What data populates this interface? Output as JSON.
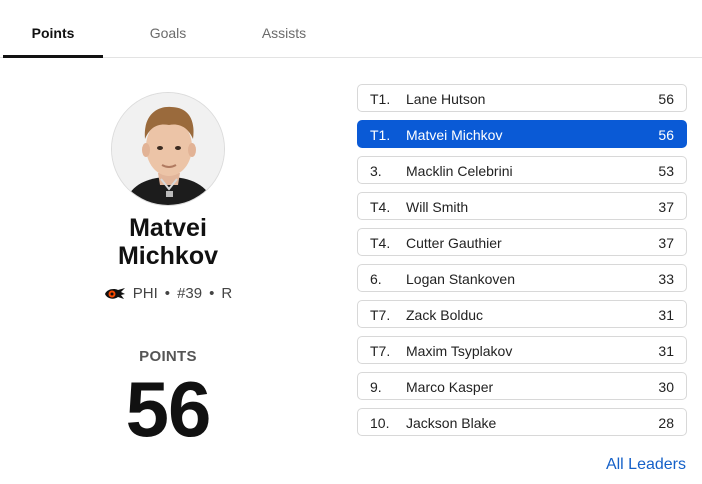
{
  "tabs": [
    {
      "label": "Points",
      "active": true
    },
    {
      "label": "Goals",
      "active": false
    },
    {
      "label": "Assists",
      "active": false
    }
  ],
  "player": {
    "first_name": "Matvei",
    "last_name": "Michkov",
    "team": "PHI",
    "number": "#39",
    "position": "R",
    "separator": "•",
    "stat_label": "POINTS",
    "stat_value": "56"
  },
  "leaders": [
    {
      "rank": "T1.",
      "name": "Lane Hutson",
      "value": "56",
      "highlight": false
    },
    {
      "rank": "T1.",
      "name": "Matvei Michkov",
      "value": "56",
      "highlight": true
    },
    {
      "rank": "3.",
      "name": "Macklin Celebrini",
      "value": "53",
      "highlight": false
    },
    {
      "rank": "T4.",
      "name": "Will Smith",
      "value": "37",
      "highlight": false
    },
    {
      "rank": "T4.",
      "name": "Cutter Gauthier",
      "value": "37",
      "highlight": false
    },
    {
      "rank": "6.",
      "name": "Logan Stankoven",
      "value": "33",
      "highlight": false
    },
    {
      "rank": "T7.",
      "name": "Zack Bolduc",
      "value": "31",
      "highlight": false
    },
    {
      "rank": "T7.",
      "name": "Maxim Tsyplakov",
      "value": "31",
      "highlight": false
    },
    {
      "rank": "9.",
      "name": "Marco Kasper",
      "value": "30",
      "highlight": false
    },
    {
      "rank": "10.",
      "name": "Jackson Blake",
      "value": "28",
      "highlight": false
    }
  ],
  "footer": {
    "all_leaders_label": "All Leaders"
  },
  "colors": {
    "highlight": "#0a5ad6",
    "link": "#1460c8",
    "team_orange": "#f74902"
  },
  "icons": {
    "team_logo": "flyers-logo-icon",
    "avatar": "player-headshot"
  }
}
